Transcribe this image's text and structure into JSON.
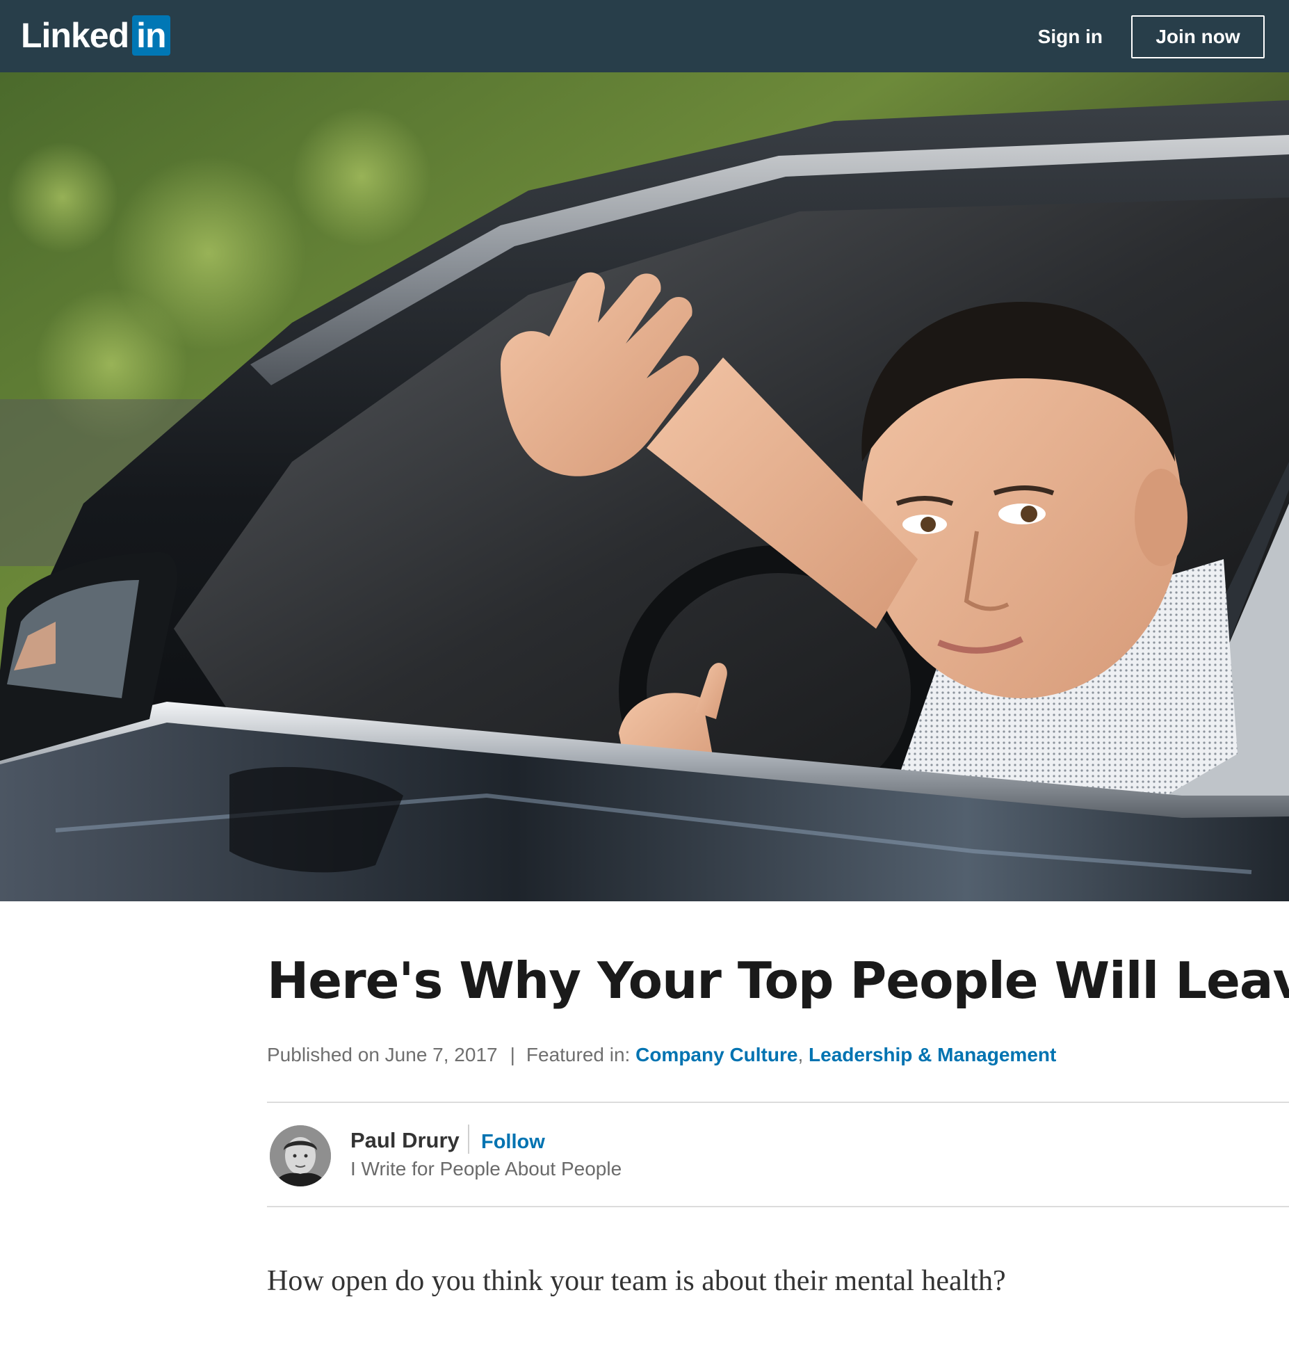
{
  "header": {
    "logo_text": "Linked",
    "logo_box_text": "in",
    "sign_in_label": "Sign in",
    "join_now_label": "Join now",
    "background_color": "#283e4a",
    "brand_color": "#0077b5"
  },
  "hero": {
    "image_alt": "Man waving from the driver's window of a dark car"
  },
  "article": {
    "title": "Here's Why Your Top People Will Leave",
    "published_label": "Published on June 7, 2017",
    "separator": "|",
    "featured_label": "Featured in:",
    "featured_topics": [
      {
        "label": "Company Culture"
      },
      {
        "label": "Leadership & Management"
      }
    ],
    "topic_separator": ",",
    "body_first_line": "How open do you think your team is about their mental health?",
    "link_color": "#0073b1"
  },
  "author": {
    "name": "Paul Drury",
    "follow_label": "Follow",
    "headline": "I Write for People About People"
  }
}
